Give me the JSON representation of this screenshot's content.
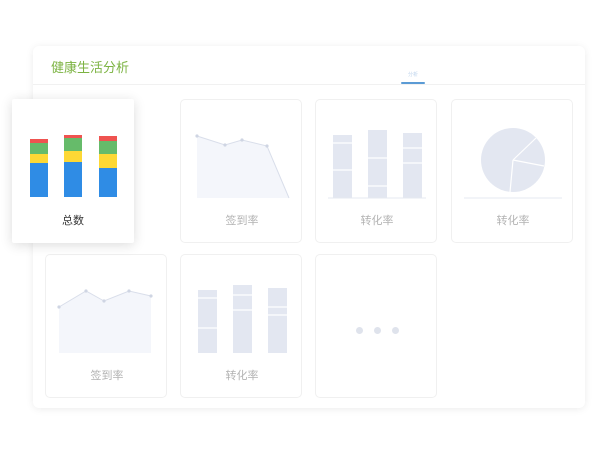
{
  "panel": {
    "title": "健康生活分析",
    "tab_label": "分析"
  },
  "colors": {
    "accent_green": "#7cb342",
    "bar_blue": "#2f8ce5",
    "bar_yellow": "#fdd835",
    "bar_green": "#66bb6a",
    "bar_red": "#ef5350",
    "placeholder": "#e3e7f1"
  },
  "cards": {
    "total": {
      "label": "总数"
    },
    "checkin_1": {
      "label": "签到率"
    },
    "conversion_1": {
      "label": "转化率"
    },
    "conversion_pie": {
      "label": "转化率"
    },
    "checkin_2": {
      "label": "签到率"
    },
    "conversion_2": {
      "label": "转化率"
    },
    "more": {
      "icon": "more-dots-icon"
    }
  }
}
